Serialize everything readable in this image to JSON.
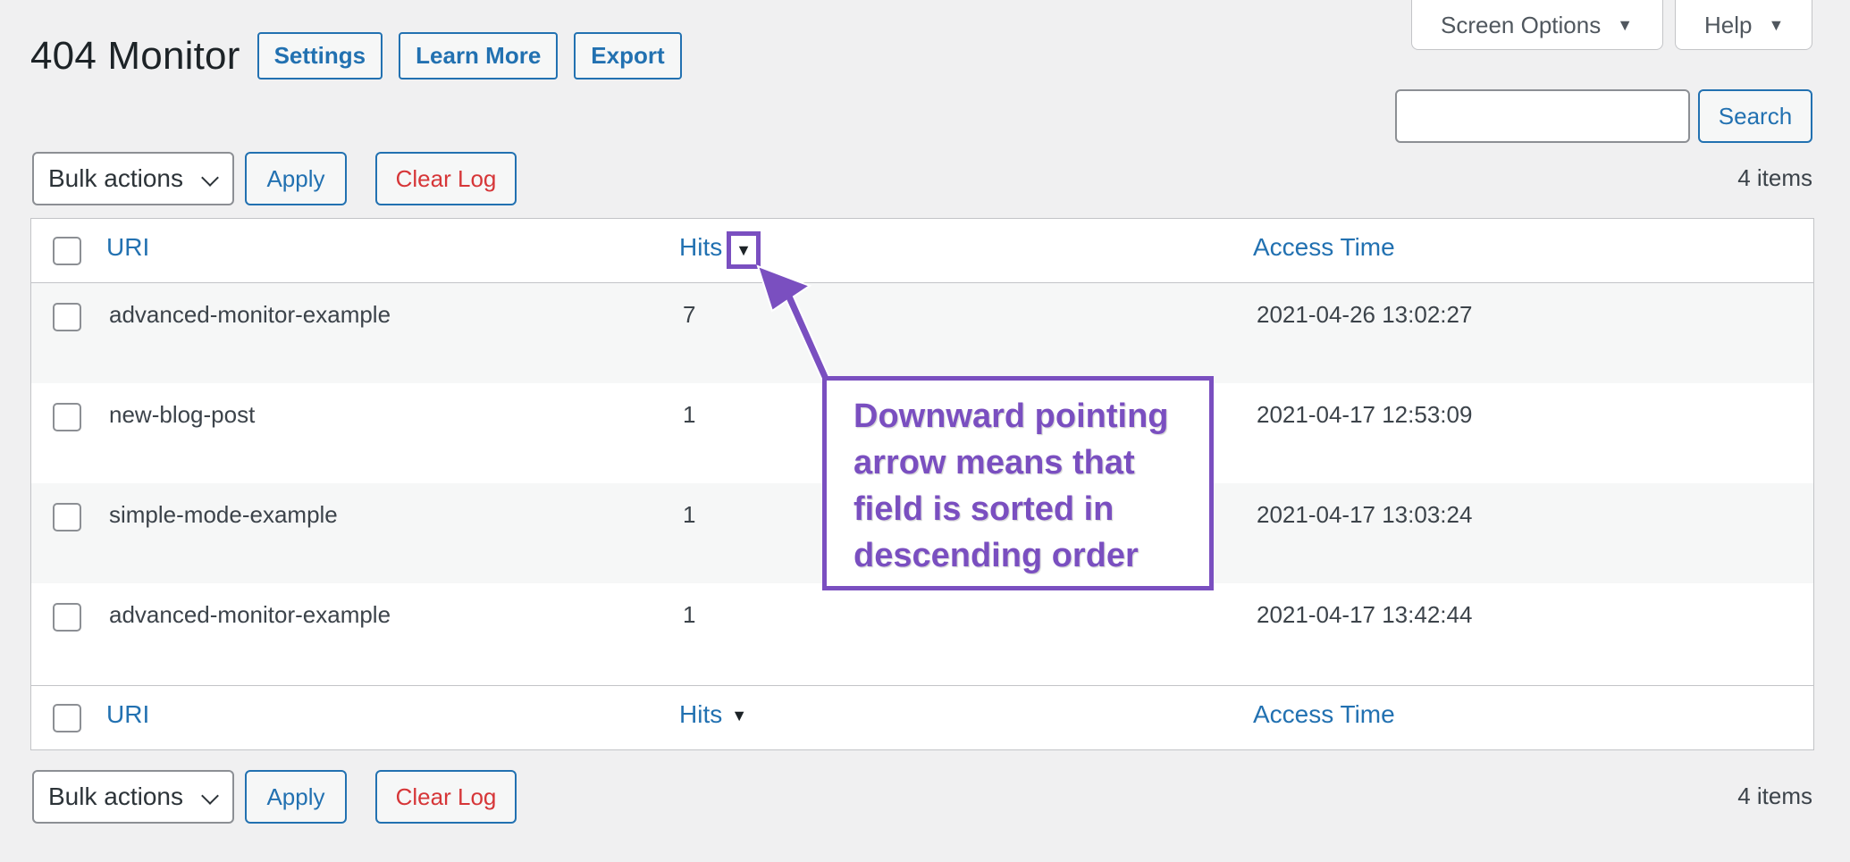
{
  "header": {
    "title": "404 Monitor",
    "buttons": [
      "Settings",
      "Learn More",
      "Export"
    ]
  },
  "screen_tabs": {
    "screen_options": "Screen Options",
    "help": "Help",
    "dropdown_glyph": "▼"
  },
  "search": {
    "value": "",
    "button": "Search"
  },
  "tablenav_top": {
    "bulk_actions": "Bulk actions",
    "apply": "Apply",
    "clear_log": "Clear Log",
    "count": "4 items"
  },
  "tablenav_bottom": {
    "bulk_actions": "Bulk actions",
    "apply": "Apply",
    "clear_log": "Clear Log",
    "count": "4 items"
  },
  "table": {
    "columns": {
      "uri": "URI",
      "hits": "Hits",
      "access_time": "Access Time",
      "sort_indicator": "▼"
    },
    "rows": [
      {
        "uri": "advanced-monitor-example",
        "hits": "7",
        "access_time": "2021-04-26 13:02:27"
      },
      {
        "uri": "new-blog-post",
        "hits": "1",
        "access_time": "2021-04-17 12:53:09"
      },
      {
        "uri": "simple-mode-example",
        "hits": "1",
        "access_time": "2021-04-17 13:03:24"
      },
      {
        "uri": "advanced-monitor-example",
        "hits": "1",
        "access_time": "2021-04-17 13:42:44"
      }
    ]
  },
  "annotation": {
    "text": "Downward pointing\narrow means that\nfield is sorted in\ndescending order",
    "color": "#7a4fc0"
  },
  "colors": {
    "link": "#2271b1",
    "danger": "#d63638",
    "background": "#f0f0f1"
  }
}
